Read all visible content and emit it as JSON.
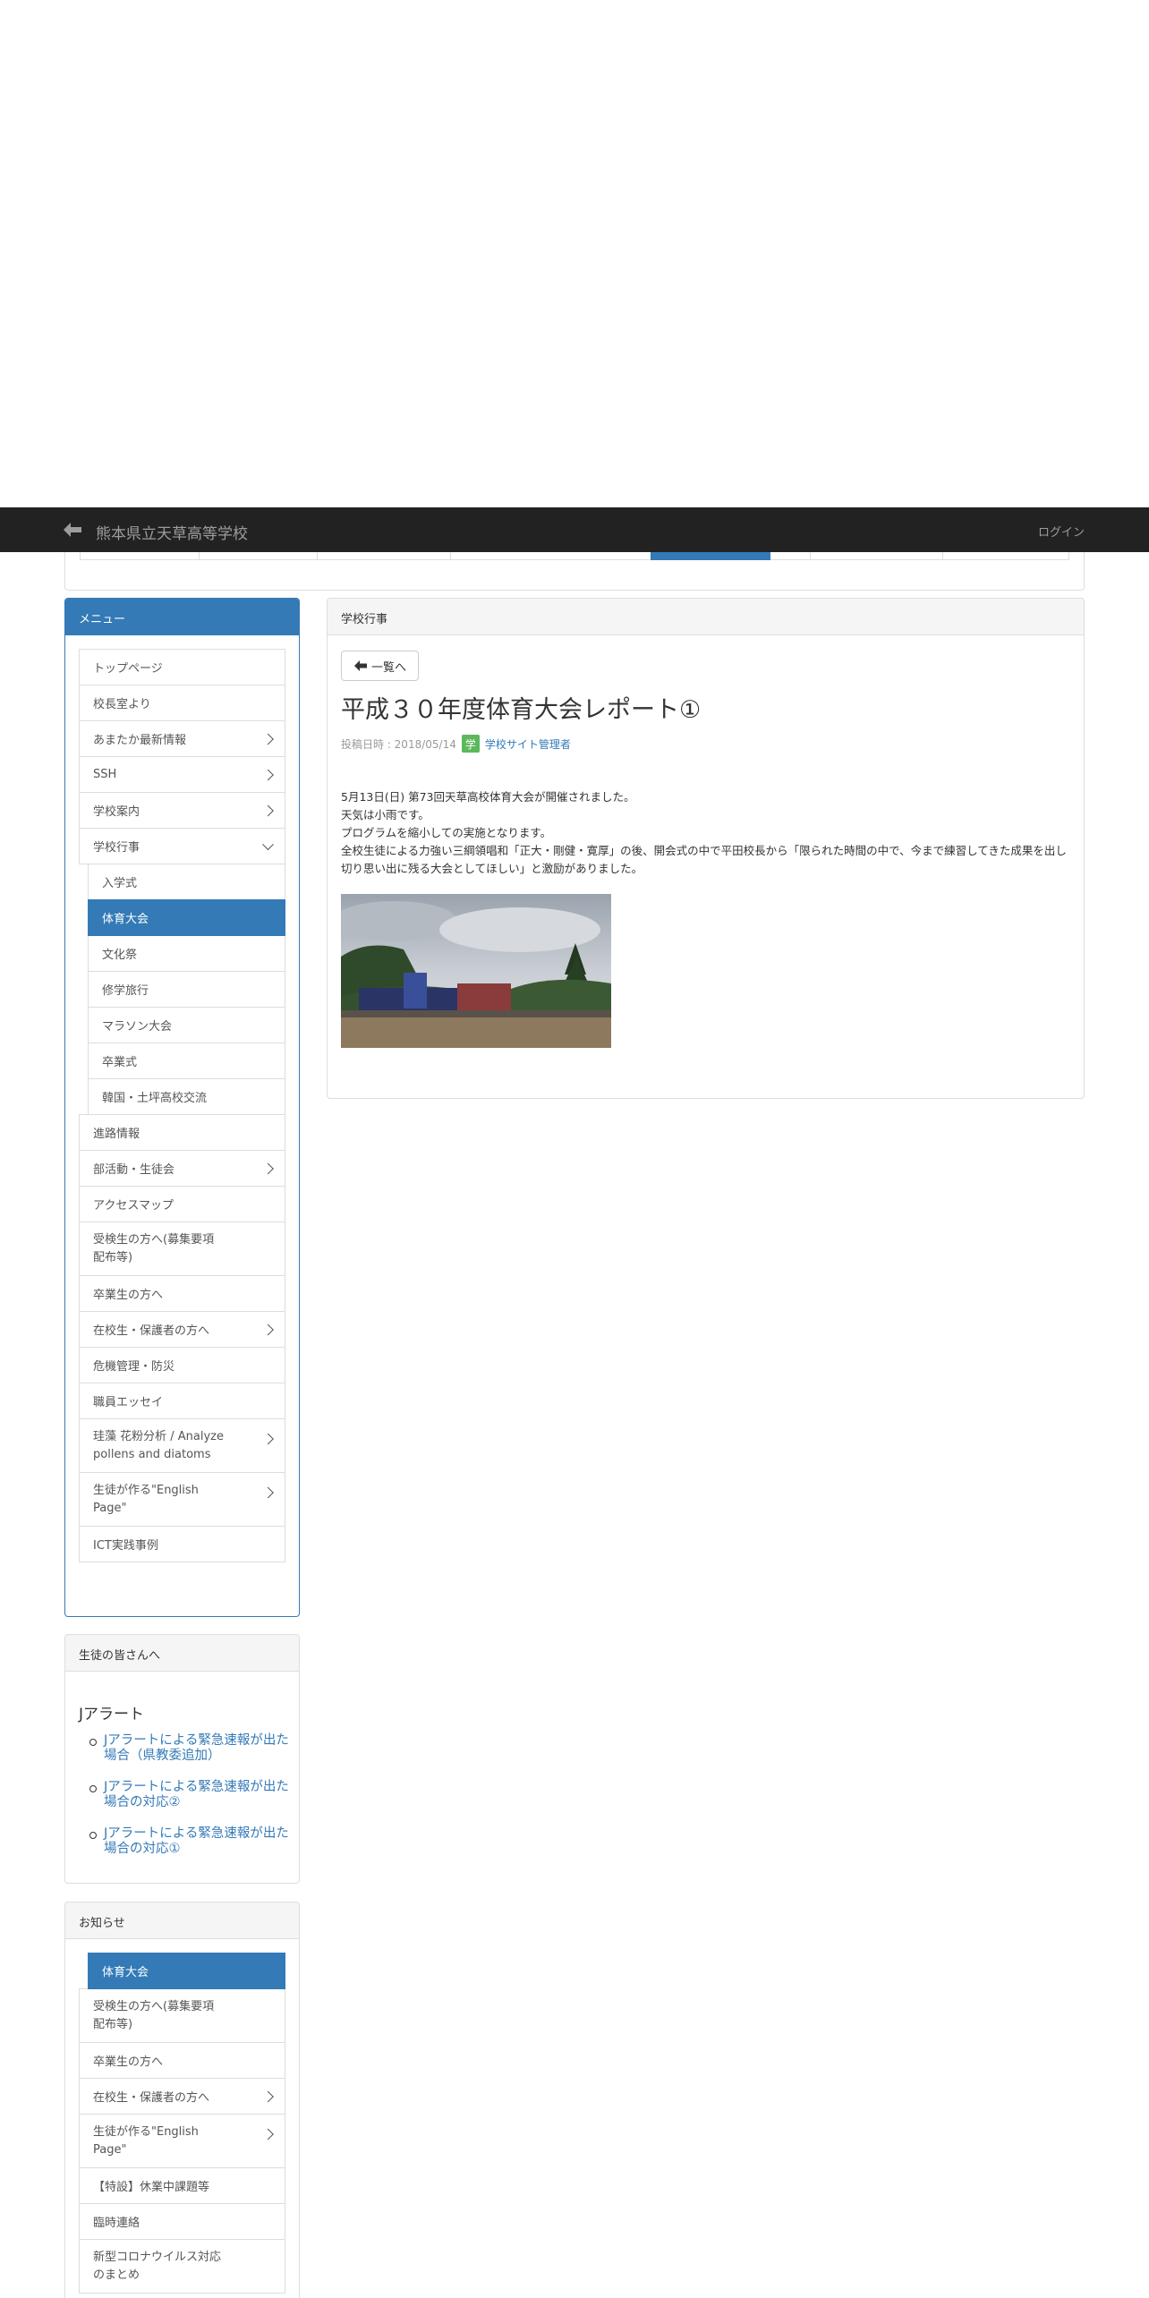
{
  "navbar": {
    "site_title": "熊本県立天草高等学校",
    "login_label": "ログイン",
    "back_icon": "arrow-left-icon"
  },
  "menu_panel": {
    "heading": "メニュー",
    "items": [
      {
        "label": "トップページ"
      },
      {
        "label": "校長室より"
      },
      {
        "label": "あまたか最新情報"
      },
      {
        "label": "SSH"
      },
      {
        "label": "学校案内"
      },
      {
        "label": "学校行事"
      },
      {
        "label": "入学式"
      },
      {
        "label": "体育大会"
      },
      {
        "label": "文化祭"
      },
      {
        "label": "修学旅行"
      },
      {
        "label": "マラソン大会"
      },
      {
        "label": "卒業式"
      },
      {
        "label": "韓国・土坪高校交流"
      },
      {
        "label": "進路情報"
      },
      {
        "label": "部活動・生徒会"
      },
      {
        "label": "アクセスマップ"
      },
      {
        "label": "受検生の方へ(募集要項\n配布等)"
      },
      {
        "label": "卒業生の方へ"
      },
      {
        "label": "在校生・保護者の方へ"
      },
      {
        "label": "危機管理・防災"
      },
      {
        "label": "職員エッセイ"
      },
      {
        "label": "珪藻 花粉分析 / Analyze\npollens and diatoms"
      },
      {
        "label": "生徒が作る\"English\nPage\""
      },
      {
        "label": "ICT実践事例"
      }
    ]
  },
  "students_panel": {
    "heading": "生徒の皆さんへ",
    "section_title": "Jアラート",
    "links": [
      {
        "label": "Jアラートによる緊急速報が出た場合（県教委追加）"
      },
      {
        "label": "Jアラートによる緊急速報が出た場合の対応②"
      },
      {
        "label": "Jアラートによる緊急速報が出た場合の対応①"
      }
    ]
  },
  "news_panel": {
    "heading": "お知らせ",
    "items": [
      {
        "label": "体育大会"
      },
      {
        "label": "受検生の方へ(募集要項\n配布等)"
      },
      {
        "label": "卒業生の方へ"
      },
      {
        "label": "在校生・保護者の方へ"
      },
      {
        "label": "生徒が作る\"English\nPage\""
      },
      {
        "label": "【特設】休業中課題等"
      },
      {
        "label": "臨時連絡"
      },
      {
        "label": "新型コロナウイルス対応\nのまとめ"
      }
    ]
  },
  "main": {
    "heading": "学校行事",
    "back_button_label": "一覧へ",
    "post_title": "平成３０年度体育大会レポート①",
    "posted_label": "投稿日時 : 2018/05/14",
    "author_badge": "学",
    "author_name": "学校サイト管理者",
    "body_lines": [
      "5月13日(日) 第73回天草高校体育大会が開催されました。",
      "天気は小雨です。",
      "プログラムを縮小しての実施となります。",
      "全校生徒による力強い三綱領唱和「正大・剛健・寛厚」の後、開会式の中で平田校長から「限られた時間の中で、今まで練習してきた成果を出し切り思い出に残る大会としてほしい」と激励がありました。"
    ]
  },
  "colors": {
    "navbar": "#222222",
    "primary": "#337ab7",
    "badge": "#5cb85c"
  }
}
